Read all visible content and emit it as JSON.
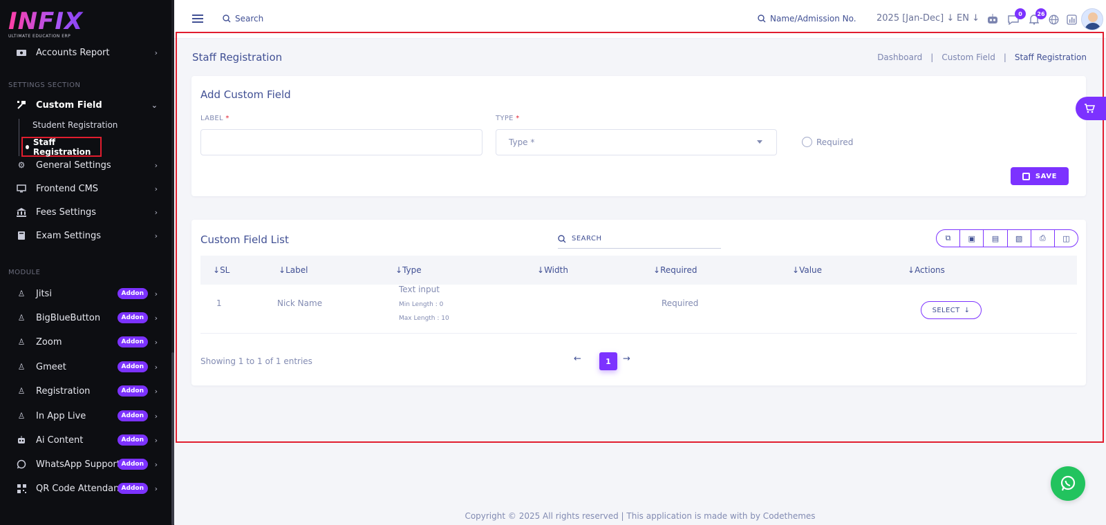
{
  "sidebar": {
    "logo": {
      "brand": "INFIX",
      "tagline": "ULTIMATE EDUCATION ERP"
    },
    "items_top": [
      {
        "label": "Accounts Report",
        "icon": "wallet-icon"
      }
    ],
    "settings_section": "SETTINGS SECTION",
    "custom_field": {
      "label": "Custom Field",
      "icon": "tools-icon"
    },
    "sub_items": [
      {
        "label": "Student Registration"
      },
      {
        "label": "Staff Registration",
        "active": true
      }
    ],
    "settings_items": [
      {
        "label": "General Settings",
        "icon": "gears-icon"
      },
      {
        "label": "Frontend CMS",
        "icon": "desktop-icon"
      },
      {
        "label": "Fees Settings",
        "icon": "bank-icon"
      },
      {
        "label": "Exam Settings",
        "icon": "book-icon"
      }
    ],
    "module_section": "MODULE",
    "module_items": [
      {
        "label": "Jitsi",
        "badge": "Addon"
      },
      {
        "label": "BigBlueButton",
        "badge": "Addon"
      },
      {
        "label": "Zoom",
        "badge": "Addon"
      },
      {
        "label": "Gmeet",
        "badge": "Addon"
      },
      {
        "label": "Registration",
        "badge": "Addon"
      },
      {
        "label": "In App Live",
        "badge": "Addon"
      },
      {
        "label": "Ai Content",
        "badge": "Addon"
      },
      {
        "label": "WhatsApp Support",
        "badge": "Addon"
      },
      {
        "label": "QR Code Attendance",
        "badge": "Addon"
      }
    ]
  },
  "topbar": {
    "search_label": "Search",
    "admission_search_label": "Name/Admission No.",
    "year": "2025 [Jan-Dec]",
    "language": "EN",
    "chat_count": "0",
    "notification_count": "26"
  },
  "page": {
    "title": "Staff Registration",
    "breadcrumb": [
      "Dashboard",
      "Custom Field",
      "Staff Registration"
    ]
  },
  "form": {
    "title": "Add Custom Field",
    "label_field": {
      "label": "LABEL",
      "required_mark": "*",
      "value": ""
    },
    "type_field": {
      "label": "TYPE",
      "required_mark": "*",
      "placeholder": "Type *"
    },
    "required_option": "Required",
    "save_label": "SAVE"
  },
  "list": {
    "title": "Custom Field List",
    "search_placeholder": "SEARCH",
    "columns": [
      "SL",
      "Label",
      "Type",
      "Width",
      "Required",
      "Value",
      "Actions"
    ],
    "rows": [
      {
        "sl": "1",
        "label": "Nick Name",
        "type": "Text input",
        "min_length": "Min Length : 0",
        "max_length": "Max Length : 10",
        "width": "",
        "required": "Required",
        "value": "",
        "action": "SELECT"
      }
    ],
    "showing": "Showing 1 to 1 of 1 entries",
    "current_page": "1"
  },
  "footer": {
    "text": "Copyright © 2025 All rights reserved | This application is made with by Codethemes"
  },
  "colors": {
    "accent": "#7c32ff",
    "sidebar_bg": "#0d0e12",
    "highlight": "#e11d2e"
  }
}
